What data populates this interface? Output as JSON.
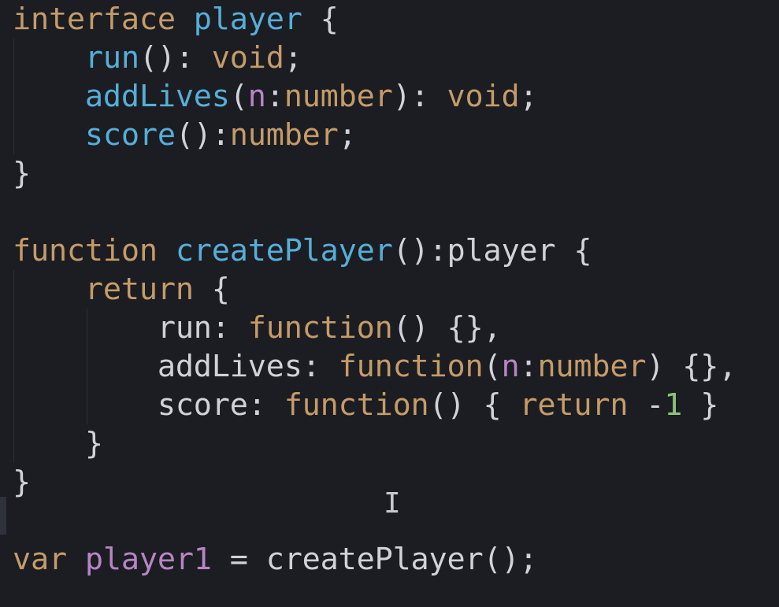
{
  "code_lines": [
    [
      {
        "t": "interface",
        "c": "kw"
      },
      {
        "t": " ",
        "c": "id"
      },
      {
        "t": "player",
        "c": "fn"
      },
      {
        "t": " {",
        "c": "id"
      }
    ],
    [
      {
        "t": "    ",
        "c": "id"
      },
      {
        "t": "run",
        "c": "fn"
      },
      {
        "t": "(): ",
        "c": "id"
      },
      {
        "t": "void",
        "c": "kw"
      },
      {
        "t": ";",
        "c": "id"
      }
    ],
    [
      {
        "t": "    ",
        "c": "id"
      },
      {
        "t": "addLives",
        "c": "fn"
      },
      {
        "t": "(",
        "c": "id"
      },
      {
        "t": "n",
        "c": "pa"
      },
      {
        "t": ":",
        "c": "id"
      },
      {
        "t": "number",
        "c": "kw"
      },
      {
        "t": "): ",
        "c": "id"
      },
      {
        "t": "void",
        "c": "kw"
      },
      {
        "t": ";",
        "c": "id"
      }
    ],
    [
      {
        "t": "    ",
        "c": "id"
      },
      {
        "t": "score",
        "c": "fn"
      },
      {
        "t": "():",
        "c": "id"
      },
      {
        "t": "number",
        "c": "kw"
      },
      {
        "t": ";",
        "c": "id"
      }
    ],
    [
      {
        "t": "}",
        "c": "id"
      }
    ],
    [],
    [
      {
        "t": "function",
        "c": "kw"
      },
      {
        "t": " ",
        "c": "id"
      },
      {
        "t": "createPlayer",
        "c": "fn"
      },
      {
        "t": "():player {",
        "c": "id"
      }
    ],
    [
      {
        "t": "    ",
        "c": "id"
      },
      {
        "t": "return",
        "c": "kw"
      },
      {
        "t": " {",
        "c": "id"
      }
    ],
    [
      {
        "t": "        ",
        "c": "id"
      },
      {
        "t": "run: ",
        "c": "id"
      },
      {
        "t": "function",
        "c": "kw"
      },
      {
        "t": "() {},",
        "c": "id"
      }
    ],
    [
      {
        "t": "        ",
        "c": "id"
      },
      {
        "t": "addLives: ",
        "c": "id"
      },
      {
        "t": "function",
        "c": "kw"
      },
      {
        "t": "(",
        "c": "id"
      },
      {
        "t": "n",
        "c": "pa"
      },
      {
        "t": ":",
        "c": "id"
      },
      {
        "t": "number",
        "c": "kw"
      },
      {
        "t": ") {},",
        "c": "id"
      }
    ],
    [
      {
        "t": "        ",
        "c": "id"
      },
      {
        "t": "score: ",
        "c": "id"
      },
      {
        "t": "function",
        "c": "kw"
      },
      {
        "t": "() { ",
        "c": "id"
      },
      {
        "t": "return",
        "c": "kw"
      },
      {
        "t": " -",
        "c": "id"
      },
      {
        "t": "1",
        "c": "nu"
      },
      {
        "t": " }",
        "c": "id"
      }
    ],
    [
      {
        "t": "    }",
        "c": "id"
      }
    ],
    [
      {
        "t": "}",
        "c": "id"
      }
    ],
    [],
    [
      {
        "t": "var",
        "c": "kw"
      },
      {
        "t": " ",
        "c": "id"
      },
      {
        "t": "player1",
        "c": "pa"
      },
      {
        "t": " = createPlayer();",
        "c": "id"
      }
    ]
  ],
  "colors": {
    "background": "#1b1d22",
    "keyword": "#c59b68",
    "function_name": "#56aed8",
    "identifier": "#cfd2d8",
    "parameter": "#b884c4",
    "number": "#8cc37a"
  },
  "cursor_icon": "i-beam-cursor-icon",
  "cursor_glyph": "I"
}
